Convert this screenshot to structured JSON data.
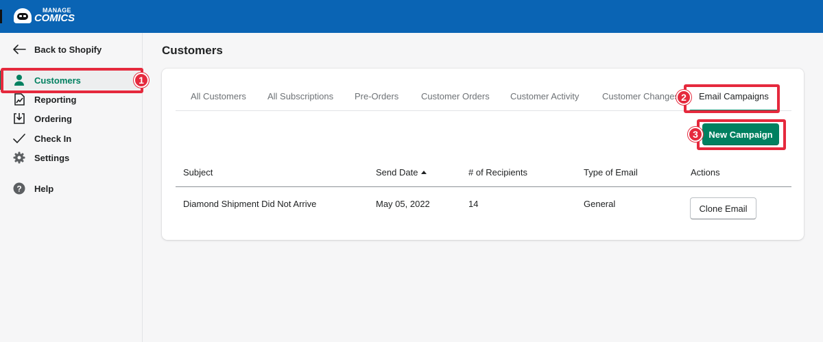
{
  "brand": {
    "top": "MANAGE",
    "bottom": "COMICS"
  },
  "sidebar": {
    "back_label": "Back to Shopify",
    "items": [
      {
        "label": "Customers",
        "icon": "person-icon",
        "active": true
      },
      {
        "label": "Reporting",
        "icon": "reporting-icon"
      },
      {
        "label": "Ordering",
        "icon": "ordering-icon"
      },
      {
        "label": "Check In",
        "icon": "checkmark-icon"
      },
      {
        "label": "Settings",
        "icon": "gear-icon"
      },
      {
        "label": "Help",
        "icon": "help-icon"
      }
    ]
  },
  "page": {
    "title": "Customers"
  },
  "tabs": [
    {
      "label": "All Customers"
    },
    {
      "label": "All Subscriptions"
    },
    {
      "label": "Pre-Orders"
    },
    {
      "label": "Customer Orders"
    },
    {
      "label": "Customer Activity"
    },
    {
      "label": "Customer Changes"
    },
    {
      "label": "Email Campaigns",
      "active": true
    }
  ],
  "actions": {
    "new_campaign_label": "New Campaign"
  },
  "table": {
    "columns": [
      "Subject",
      "Send Date",
      "# of Recipients",
      "Type of Email",
      "Actions"
    ],
    "sort_column": "Send Date",
    "rows": [
      {
        "subject": "Diamond Shipment Did Not Arrive",
        "send_date": "May 05, 2022",
        "recipients": "14",
        "type": "General",
        "action_label": "Clone Email"
      }
    ]
  },
  "annotations": [
    {
      "number": "1",
      "target": "Customers"
    },
    {
      "number": "2",
      "target": "Email Campaigns"
    },
    {
      "number": "3",
      "target": "New Campaign"
    }
  ],
  "colors": {
    "topbar": "#0a64b4",
    "accent": "#008060",
    "annotation": "#e5293d"
  }
}
